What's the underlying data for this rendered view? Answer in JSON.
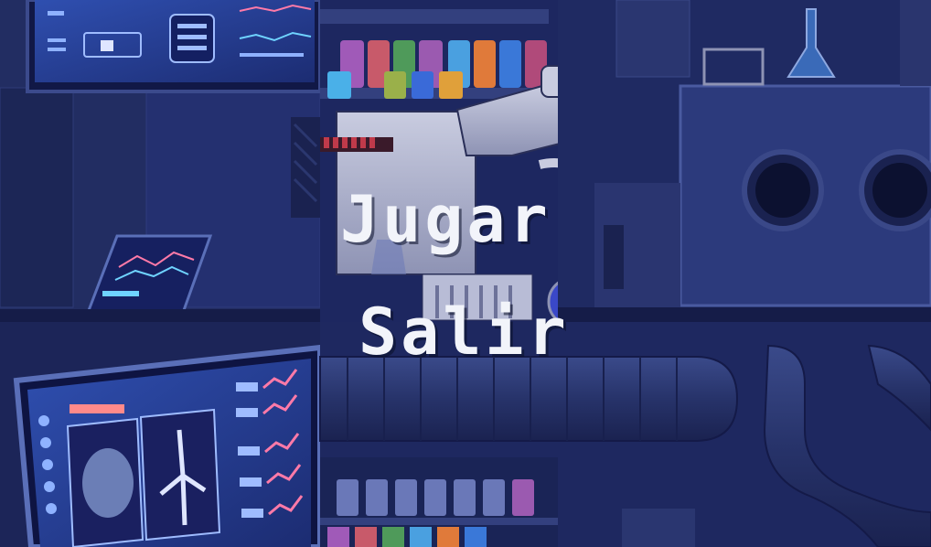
{
  "menu": {
    "play_label": "Jugar",
    "exit_label": "Salir"
  },
  "colors": {
    "background": "#1b2552",
    "menu_text": "#f2f4fa"
  }
}
